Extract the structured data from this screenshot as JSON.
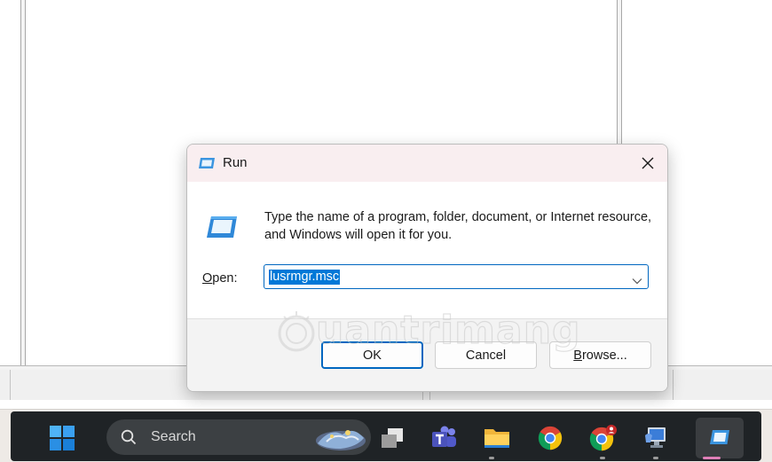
{
  "dialog": {
    "title": "Run",
    "description": "Type the name of a program, folder, document, or Internet resource, and Windows will open it for you.",
    "open_label_accel": "O",
    "open_label_rest": "pen:",
    "input_value": "lusrmgr.msc",
    "ok_label": "OK",
    "cancel_label": "Cancel",
    "browse_accel": "B",
    "browse_rest": "rowse..."
  },
  "watermark": {
    "text": "uantrimang"
  },
  "taskbar": {
    "search_placeholder": "Search",
    "items": [
      "windows-start",
      "search",
      "task-view",
      "microsoft-teams",
      "file-explorer",
      "google-chrome",
      "chrome-profile",
      "remote-desktop",
      "run"
    ]
  },
  "colors": {
    "accent": "#0067c0",
    "selection": "#0078d7",
    "titlebar": "#f9eef0",
    "taskbar": "#1f2326"
  }
}
